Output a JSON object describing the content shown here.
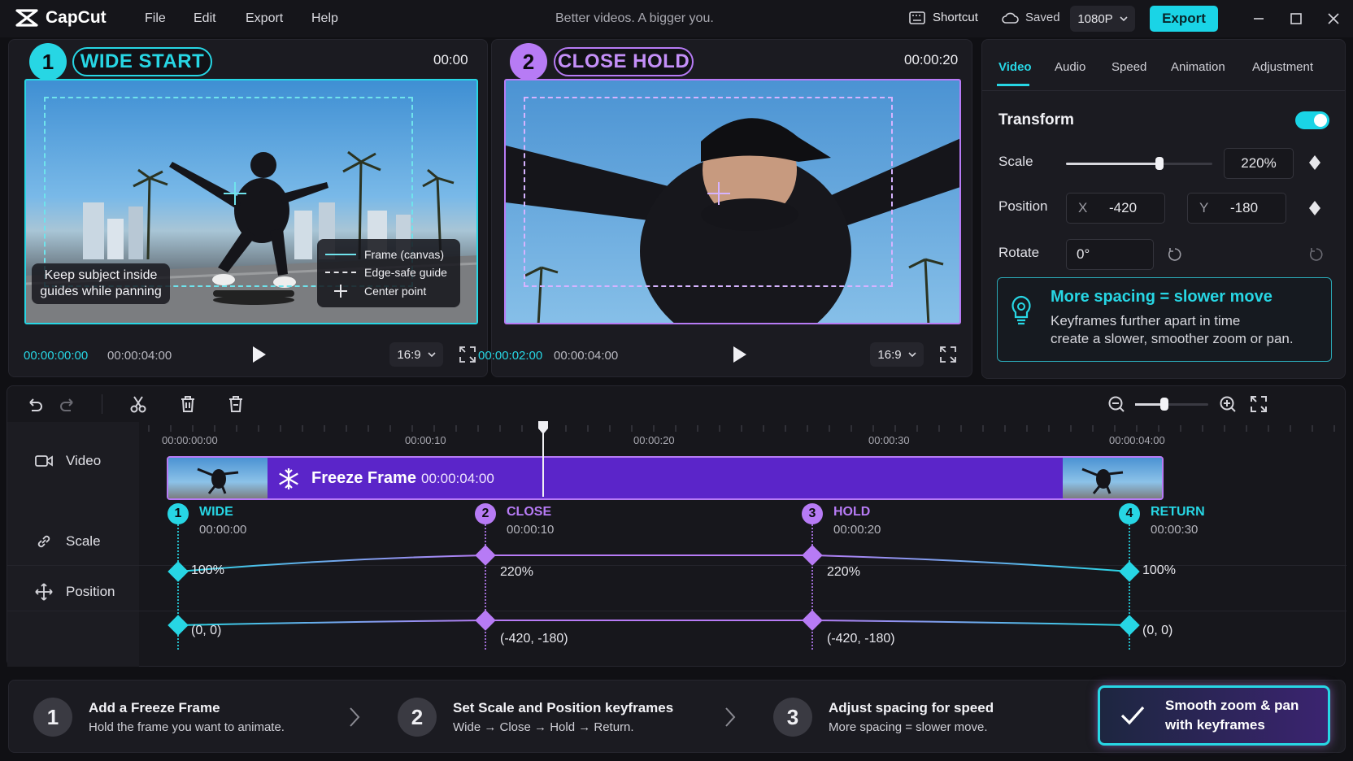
{
  "app": {
    "name": "CapCut",
    "tagline": "Better videos. A bigger you."
  },
  "menu": [
    "File",
    "Edit",
    "Export",
    "Help"
  ],
  "topbar": {
    "shortcut": "Shortcut",
    "saved": "Saved",
    "resolution": "1080P",
    "export": "Export"
  },
  "preview1": {
    "num": "1",
    "title": "WIDE START",
    "time": "00:00",
    "hint_line1": "Keep subject inside",
    "hint_line2": "guides while panning",
    "legend": [
      "Frame (canvas)",
      "Edge-safe guide",
      "Center point"
    ],
    "current": "00:00:00:00",
    "duration": "00:00:04:00",
    "ratio": "16:9"
  },
  "preview2": {
    "num": "2",
    "title": "CLOSE HOLD",
    "time": "00:00:20",
    "current": "00:00:02:00",
    "duration": "00:00:04:00",
    "ratio": "16:9"
  },
  "inspector": {
    "tabs": [
      "Video",
      "Audio",
      "Speed",
      "Animation",
      "Adjustment"
    ],
    "section": "Transform",
    "scale_label": "Scale",
    "scale_value": "220%",
    "scale_slider": 0.64,
    "position_label": "Position",
    "x_label": "X",
    "x_value": "-420",
    "y_label": "Y",
    "y_value": "-180",
    "rotate_label": "Rotate",
    "rotate_value": "0°",
    "tip_title": "More spacing = slower move",
    "tip_line1": "Keyframes further apart in time",
    "tip_line2": "create a slower, smoother zoom or pan."
  },
  "timeline": {
    "ruler": [
      "00:00:00:00",
      "00:00:10",
      "00:00:20",
      "00:00:30",
      "00:00:04:00"
    ],
    "tracks": {
      "video": "Video",
      "scale": "Scale",
      "position": "Position"
    },
    "clip_label": "Freeze Frame",
    "clip_duration": "00:00:04:00",
    "zoom": 0.4,
    "keyframes": [
      {
        "num": "1",
        "name": "WIDE",
        "time": "00:00:00",
        "scale": "100%",
        "position": "(0, 0)",
        "color": "#27d6e4"
      },
      {
        "num": "2",
        "name": "CLOSE",
        "time": "00:00:10",
        "scale": "220%",
        "position": "(-420, -180)",
        "color": "#b77bf5"
      },
      {
        "num": "3",
        "name": "HOLD",
        "time": "00:00:20",
        "scale": "220%",
        "position": "(-420, -180)",
        "color": "#b77bf5"
      },
      {
        "num": "4",
        "name": "RETURN",
        "time": "00:00:30",
        "scale": "100%",
        "position": "(0, 0)",
        "color": "#27d6e4"
      }
    ]
  },
  "steps": [
    {
      "num": "1",
      "title": "Add a Freeze Frame",
      "sub": "Hold the frame you want to animate."
    },
    {
      "num": "2",
      "title": "Set Scale and Position keyframes",
      "sub": "Wide → Close → Hold → Return."
    },
    {
      "num": "3",
      "title": "Adjust spacing for speed",
      "sub": "More spacing = slower move."
    }
  ],
  "badge": {
    "line1": "Smooth zoom & pan",
    "line2": "with keyframes"
  },
  "colors": {
    "cyan": "#27d6e4",
    "purple": "#b77bf5",
    "clip": "#5b25c9",
    "export": "#1ad4e6"
  }
}
